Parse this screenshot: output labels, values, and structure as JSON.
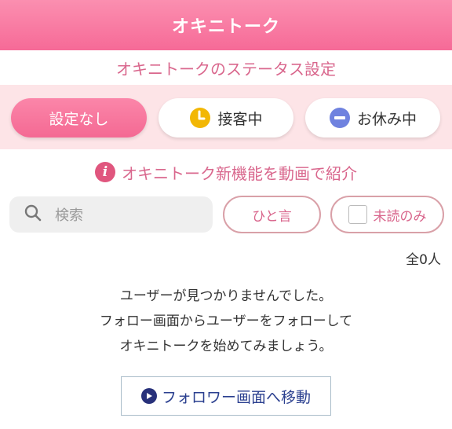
{
  "header": {
    "title": "オキニトーク"
  },
  "status_section": {
    "title": "オキニトークのステータス設定",
    "options": [
      {
        "label": "設定なし",
        "active": true,
        "icon": ""
      },
      {
        "label": "接客中",
        "active": false,
        "icon": "clock-icon"
      },
      {
        "label": "お休み中",
        "active": false,
        "icon": "minus-circle-icon"
      }
    ]
  },
  "promo": {
    "text": "オキニトーク新機能を動画で紹介",
    "icon": "info-icon"
  },
  "search": {
    "placeholder": "検索",
    "icon": "search-icon"
  },
  "filters": {
    "hitokoto_label": "ひと言",
    "unread_label": "未読のみ",
    "unread_checked": false
  },
  "result_count": "全0人",
  "empty_state": {
    "line1": "ユーザーが見つかりませんでした。",
    "line2": "フォロー画面からユーザーをフォローして",
    "line3": "オキニトークを始めてみましょう。"
  },
  "follow_button": {
    "label": "フォロワー画面へ移動",
    "icon": "play-circle-icon"
  },
  "colors": {
    "brand_pink": "#f66a97",
    "text_pink": "#d9678d",
    "band_bg": "#fde4e7",
    "clock_yellow": "#f2b705",
    "rest_blue": "#6f82df",
    "link_navy": "#2a3f8f"
  }
}
